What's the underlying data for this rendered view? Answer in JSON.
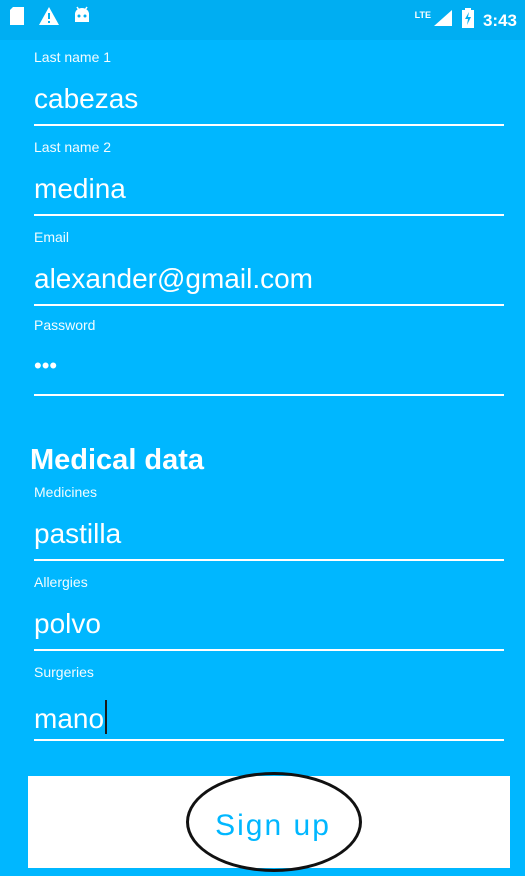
{
  "status_bar": {
    "icons_left": [
      "sd-card-icon",
      "warning-icon",
      "android-icon"
    ],
    "network": "LTE",
    "time": "3:43"
  },
  "form": {
    "last_name_1": {
      "label": "Last name 1",
      "value": "cabezas"
    },
    "last_name_2": {
      "label": "Last name 2",
      "value": "medina"
    },
    "email": {
      "label": "Email",
      "value": "alexander@gmail.com"
    },
    "password": {
      "label": "Password",
      "value": "•••"
    }
  },
  "medical": {
    "title": "Medical data",
    "medicines": {
      "label": "Medicines",
      "value": "pastilla"
    },
    "allergies": {
      "label": "Allergies",
      "value": "polvo"
    },
    "surgeries": {
      "label": "Surgeries",
      "value": "mano"
    }
  },
  "actions": {
    "signup_label": "Sign up"
  },
  "colors": {
    "background": "#00B7FF",
    "statusbar": "#00AEF2",
    "button_bg": "#FFFFFF",
    "button_text": "#00B7FF"
  }
}
